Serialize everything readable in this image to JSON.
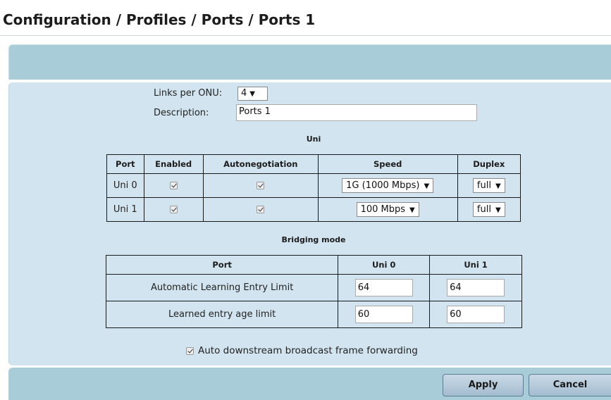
{
  "breadcrumb": "Configuration / Profiles / Ports / Ports 1",
  "form": {
    "links_label": "Links per ONU:",
    "links_value": "4",
    "description_label": "Description:",
    "description_value": "Ports 1"
  },
  "uni": {
    "title": "Uni",
    "headers": {
      "port": "Port",
      "enabled": "Enabled",
      "autoneg": "Autonegotiation",
      "speed": "Speed",
      "duplex": "Duplex"
    },
    "rows": [
      {
        "port": "Uni 0",
        "enabled": true,
        "autoneg": true,
        "speed": "1G (1000 Mbps)",
        "duplex": "full"
      },
      {
        "port": "Uni 1",
        "enabled": true,
        "autoneg": true,
        "speed": "100 Mbps",
        "duplex": "full"
      }
    ]
  },
  "bridging": {
    "title": "Bridging mode",
    "headers": {
      "port": "Port",
      "uni0": "Uni 0",
      "uni1": "Uni 1"
    },
    "rows": [
      {
        "label": "Automatic Learning Entry Limit",
        "uni0": "64",
        "uni1": "64"
      },
      {
        "label": "Learned entry age limit",
        "uni0": "60",
        "uni1": "60"
      }
    ]
  },
  "auto_forwarding": {
    "label": "Auto downstream broadcast frame forwarding",
    "checked": true
  },
  "buttons": {
    "apply": "Apply",
    "cancel": "Cancel"
  },
  "icons": {
    "select_arrow": "chevron-down-icon",
    "checkbox": "checkbox-checked-icon"
  }
}
